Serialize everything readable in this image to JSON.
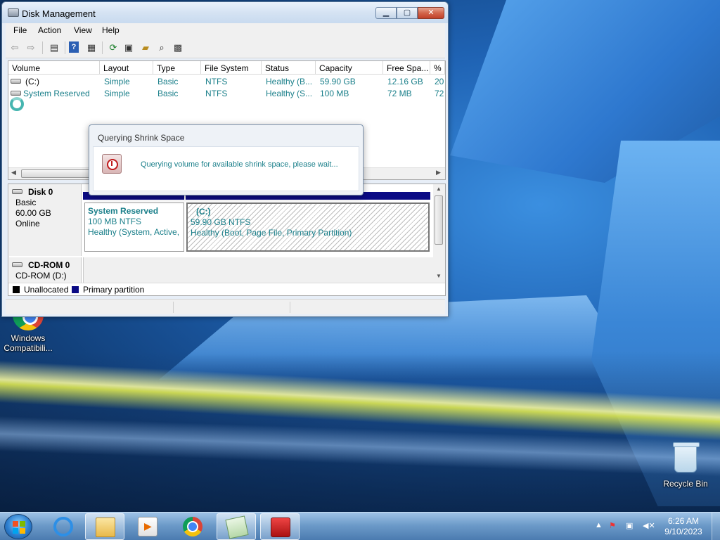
{
  "window": {
    "title": "Disk Management",
    "menu": [
      "File",
      "Action",
      "View",
      "Help"
    ]
  },
  "volumes": {
    "columns": [
      "Volume",
      "Layout",
      "Type",
      "File System",
      "Status",
      "Capacity",
      "Free Spa...",
      "% F"
    ],
    "rows": [
      {
        "volume": "(C:)",
        "layout": "Simple",
        "type": "Basic",
        "fs": "NTFS",
        "status": "Healthy (B...",
        "capacity": "59.90 GB",
        "free": "12.16 GB",
        "pct": "20"
      },
      {
        "volume": "System Reserved",
        "layout": "Simple",
        "type": "Basic",
        "fs": "NTFS",
        "status": "Healthy (S...",
        "capacity": "100 MB",
        "free": "72 MB",
        "pct": "72"
      }
    ]
  },
  "disks": {
    "disk0": {
      "name": "Disk 0",
      "type": "Basic",
      "size": "60.00 GB",
      "state": "Online",
      "partitions": [
        {
          "name": "System Reserved",
          "size": "100 MB NTFS",
          "status": "Healthy (System, Active,"
        },
        {
          "name": "(C:)",
          "size": "59.90 GB NTFS",
          "status": "Healthy (Boot, Page File, Primary Partition)"
        }
      ]
    },
    "cdrom0": {
      "name": "CD-ROM 0",
      "drive": "CD-ROM (D:)"
    },
    "legend": [
      {
        "label": "Unallocated",
        "color": "#000000"
      },
      {
        "label": "Primary partition",
        "color": "#0b0b85"
      }
    ]
  },
  "dialog": {
    "title": "Querying Shrink Space",
    "message": "Querying volume for available shrink space, please wait..."
  },
  "desktop": {
    "icons": [
      {
        "label": "Windows Compatibili...",
        "icon": "chrome-icon"
      },
      {
        "label": "Recycle Bin",
        "icon": "recycle-bin-icon"
      }
    ]
  },
  "taskbar": {
    "apps": [
      "internet-explorer-icon",
      "file-explorer-icon",
      "media-player-icon",
      "chrome-icon",
      "notepad-icon",
      "toolbox-icon"
    ],
    "time": "6:26 AM",
    "date": "9/10/2023"
  },
  "colors": {
    "accent_text": "#1a7f8a",
    "primary_partition": "#0b0b85",
    "close_button": "#c1412a"
  }
}
